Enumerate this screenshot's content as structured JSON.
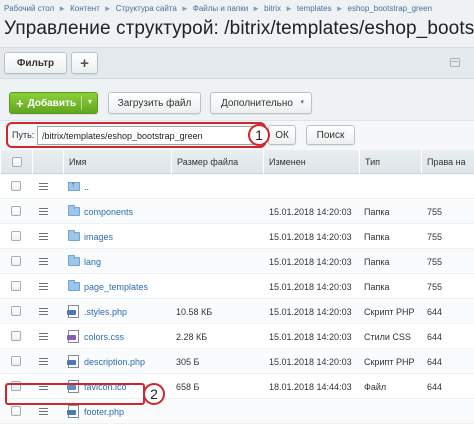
{
  "breadcrumb": [
    "Рабочий стол",
    "Контент",
    "Структура сайта",
    "Файлы и папки",
    "bitrix",
    "templates",
    "eshop_bootstrap_green"
  ],
  "breadcrumb_sep": "►",
  "title": "Управление структурой: /bitrix/templates/eshop_bootstrap_gree",
  "filter": {
    "label": "Фильтр",
    "plus": "+"
  },
  "toolbar": {
    "add_label": "Добавить",
    "add_plus": "+",
    "add_arrow": "▾",
    "upload_label": "Загрузить файл",
    "more_label": "Дополнительно",
    "more_arrow": "▾"
  },
  "path": {
    "label": "Путь:",
    "value": "/bitrix/templates/eshop_bootstrap_green",
    "ok": "ОК",
    "search": "Поиск"
  },
  "callouts": {
    "one": "1",
    "two": "2"
  },
  "columns": {
    "name": "Имя",
    "size": "Размер файла",
    "modified": "Изменен",
    "type": "Тип",
    "rights": "Права на"
  },
  "rows": [
    {
      "icon": "up-folder-icon",
      "name": "..",
      "size": "",
      "modified": "",
      "type": "",
      "rights": ""
    },
    {
      "icon": "folder-icon",
      "name": "components",
      "size": "",
      "modified": "15.01.2018 14:20:03",
      "type": "Папка",
      "rights": "755"
    },
    {
      "icon": "folder-icon",
      "name": "images",
      "size": "",
      "modified": "15.01.2018 14:20:03",
      "type": "Папка",
      "rights": "755"
    },
    {
      "icon": "folder-icon",
      "name": "lang",
      "size": "",
      "modified": "15.01.2018 14:20:03",
      "type": "Папка",
      "rights": "755"
    },
    {
      "icon": "folder-icon",
      "name": "page_templates",
      "size": "",
      "modified": "15.01.2018 14:20:03",
      "type": "Папка",
      "rights": "755"
    },
    {
      "icon": "php-file-icon",
      "name": ".styles.php",
      "size": "10.58 КБ",
      "modified": "15.01.2018 14:20:03",
      "type": "Скрипт PHP",
      "rights": "644"
    },
    {
      "icon": "css-file-icon",
      "name": "colors.css",
      "size": "2.28 КБ",
      "modified": "15.01.2018 14:20:03",
      "type": "Стили CSS",
      "rights": "644"
    },
    {
      "icon": "php-file-icon",
      "name": "description.php",
      "size": "305 Б",
      "modified": "15.01.2018 14:20:03",
      "type": "Скрипт PHP",
      "rights": "644"
    },
    {
      "icon": "ico-file-icon",
      "name": "favicon.ico",
      "size": "658 Б",
      "modified": "18.01.2018 14:44:03",
      "type": "Файл",
      "rights": "644"
    },
    {
      "icon": "php-file-icon",
      "name": "footer.php",
      "size": "",
      "modified": "",
      "type": "",
      "rights": ""
    }
  ],
  "colors": {
    "accent_green": "#62a520",
    "link": "#2b6cb0",
    "highlight": "#d0262d"
  }
}
